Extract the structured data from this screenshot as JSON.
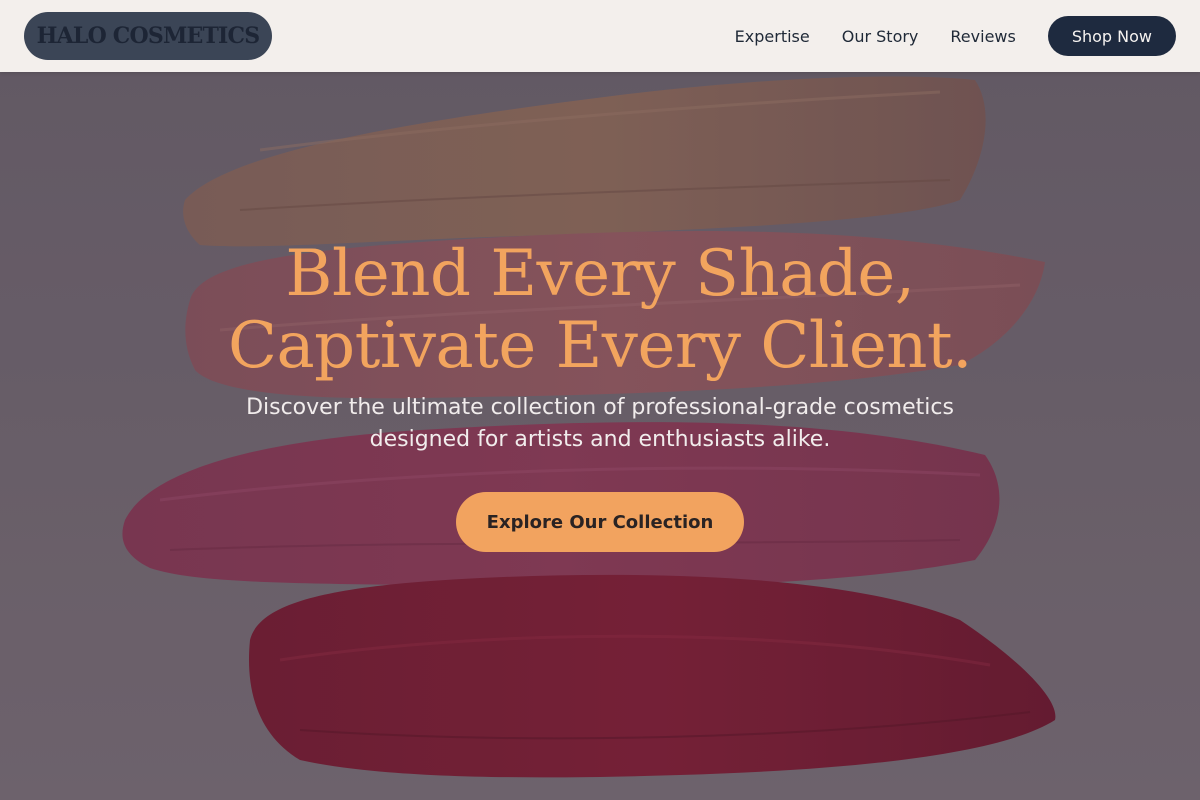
{
  "header": {
    "logo_text": "HALO COSMETICS",
    "nav": [
      {
        "label": "Expertise"
      },
      {
        "label": "Our Story"
      },
      {
        "label": "Reviews"
      }
    ],
    "shop_button_label": "Shop Now"
  },
  "hero": {
    "title_line1": "Blend Every Shade,",
    "title_line2": "Captivate Every Client.",
    "subtitle_line1": "Discover the ultimate collection of professional-grade cosmetics",
    "subtitle_line2": "designed for artists and enthusiasts alike.",
    "cta_label": "Explore Our Collection",
    "background_image": "lipstick-swatch-strokes"
  },
  "colors": {
    "header_bg": "#f3efec",
    "logo_bg": "#3b4556",
    "shop_button_bg": "#1e2a3f",
    "title_color": "#f2a45e",
    "cta_bg": "#f2a35f",
    "hero_bg": "#7a6f77"
  }
}
